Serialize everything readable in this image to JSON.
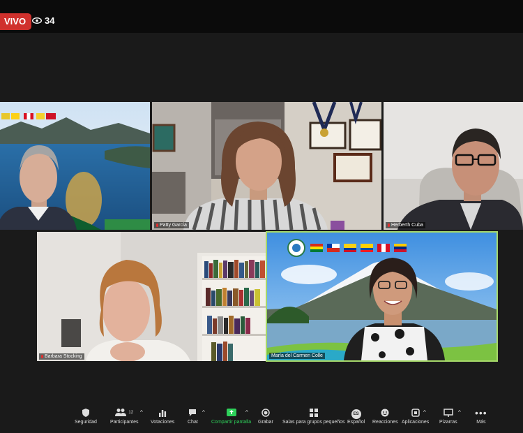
{
  "header": {
    "live_label": "VIVO",
    "viewer_count": "34"
  },
  "participants": [
    {
      "name": ""
    },
    {
      "name": "Patty García"
    },
    {
      "name": "Herberth Cuba"
    },
    {
      "name": "Barbara Stocking"
    },
    {
      "name": "María del Carmen Colle"
    }
  ],
  "toolbar": {
    "participants_count": "12",
    "items": [
      {
        "label": "Seguridad",
        "icon": "shield-icon"
      },
      {
        "label": "Participantes",
        "icon": "people-icon"
      },
      {
        "label": "Votaciones",
        "icon": "poll-icon"
      },
      {
        "label": "Chat",
        "icon": "chat-icon"
      },
      {
        "label": "Compartir pantalla",
        "icon": "share-screen-icon"
      },
      {
        "label": "Grabar",
        "icon": "record-icon"
      },
      {
        "label": "Salas para grupos pequeños",
        "icon": "breakout-rooms-icon"
      },
      {
        "label": "Español",
        "icon": "language-icon",
        "badge": "ES"
      },
      {
        "label": "Reacciones",
        "icon": "reactions-icon"
      },
      {
        "label": "Aplicaciones",
        "icon": "apps-icon"
      },
      {
        "label": "Pizarras",
        "icon": "whiteboard-icon"
      },
      {
        "label": "Más",
        "icon": "more-icon"
      }
    ]
  },
  "colors": {
    "live": "#d0312d",
    "active_speaker": "#a6d86a",
    "share_green": "#2ed15a"
  }
}
